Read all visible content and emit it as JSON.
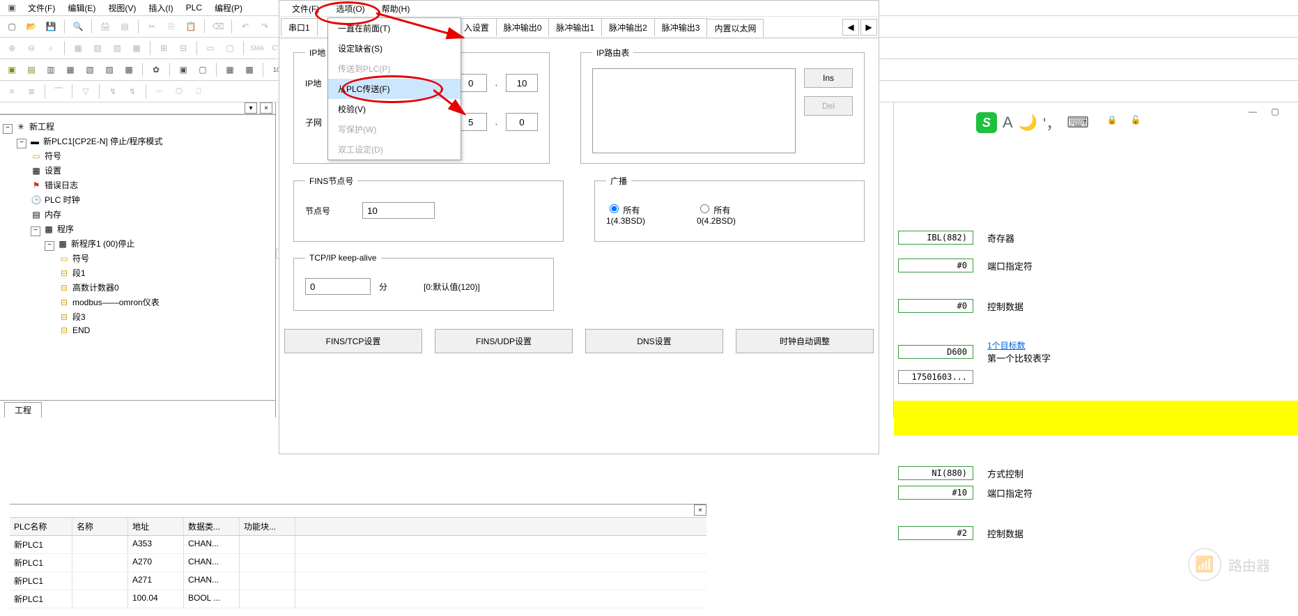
{
  "main_menu": {
    "file": "文件(F)",
    "edit": "编辑(E)",
    "view": "视图(V)",
    "insert": "插入(I)",
    "plc": "PLC",
    "program": "编程(P)"
  },
  "tree": {
    "root": "新工程",
    "plc": "新PLC1[CP2E-N] 停止/程序模式",
    "symbols": "符号",
    "settings": "设置",
    "errlog": "错误日志",
    "clock": "PLC 时钟",
    "memory": "内存",
    "programs": "程序",
    "prog1": "新程序1 (00)停止",
    "p_symbols": "符号",
    "seg1": "段1",
    "counter": "高数计数器0",
    "modbus": "modbus——omron仪表",
    "seg3": "段3",
    "end": "END",
    "tab": "工程"
  },
  "grid": {
    "headers": {
      "plc": "PLC名称",
      "name": "名称",
      "addr": "地址",
      "dtype": "数据类...",
      "fb": "功能块..."
    },
    "rows": [
      {
        "plc": "新PLC1",
        "name": "",
        "addr": "A353",
        "dtype": "CHAN...",
        "fb": ""
      },
      {
        "plc": "新PLC1",
        "name": "",
        "addr": "A270",
        "dtype": "CHAN...",
        "fb": ""
      },
      {
        "plc": "新PLC1",
        "name": "",
        "addr": "A271",
        "dtype": "CHAN...",
        "fb": ""
      },
      {
        "plc": "新PLC1",
        "name": "",
        "addr": "100.04",
        "dtype": "BOOL ...",
        "fb": ""
      }
    ]
  },
  "dialog": {
    "menu": {
      "file": "文件(F)",
      "options": "选项(O)",
      "help": "帮助(H)"
    },
    "dropdown": {
      "top": "一直在前面(T)",
      "default": "设定缺省(S)",
      "toplc": "传送到PLC(P)",
      "fromplc": "从PLC传送(F)",
      "verify": "校验(V)",
      "wprotect": "写保护(W)",
      "duplex": "双工设定(D)"
    },
    "tabs": {
      "serial": "串口1",
      "input": "入设置",
      "pulse0": "脉冲输出0",
      "pulse1": "脉冲输出1",
      "pulse2": "脉冲输出2",
      "pulse3": "脉冲输出3",
      "eth": "内置以太网"
    },
    "ip_group": "IP地",
    "ip_label": "IP地",
    "ip_tail1": "0",
    "ip_tail2": "10",
    "sub_label": "子网",
    "sub_tail1": "5",
    "sub_tail2": "0",
    "route_group": "IP路由表",
    "btn_ins": "Ins",
    "btn_del": "Del",
    "fins_group": "FINS节点号",
    "node_label": "节点号",
    "node_val": "10",
    "bc_group": "广播",
    "bc_all1": "所有1(4.3BSD)",
    "bc_all0": "所有0(4.2BSD)",
    "keep_group": "TCP/IP keep-alive",
    "keep_val": "0",
    "keep_unit": "分",
    "keep_hint": "[0:默认值(120)]",
    "btns": {
      "finstcp": "FINS/TCP设置",
      "finsudp": "FINS/UDP设置",
      "dns": "DNS设置",
      "clock": "时钟自动调整"
    }
  },
  "right": {
    "hdr1": "IBL(882)",
    "hdr1_lbl": "奇存器",
    "r1_box": "#0",
    "r1_lbl": "端口指定符",
    "r2_box": "#0",
    "r2_lbl": "控制数据",
    "r3_box": "D600",
    "r3_link": "1个目标数",
    "r3_lbl": "第一个比较表字",
    "r3_extra": "17501603...",
    "hdr2": "NI(880)",
    "hdr2_lbl": "方式控制",
    "r4_box": "#10",
    "r4_lbl": "端口指定符",
    "r5_box": "#2",
    "r5_lbl": "控制数据"
  },
  "watermark": "路由器"
}
